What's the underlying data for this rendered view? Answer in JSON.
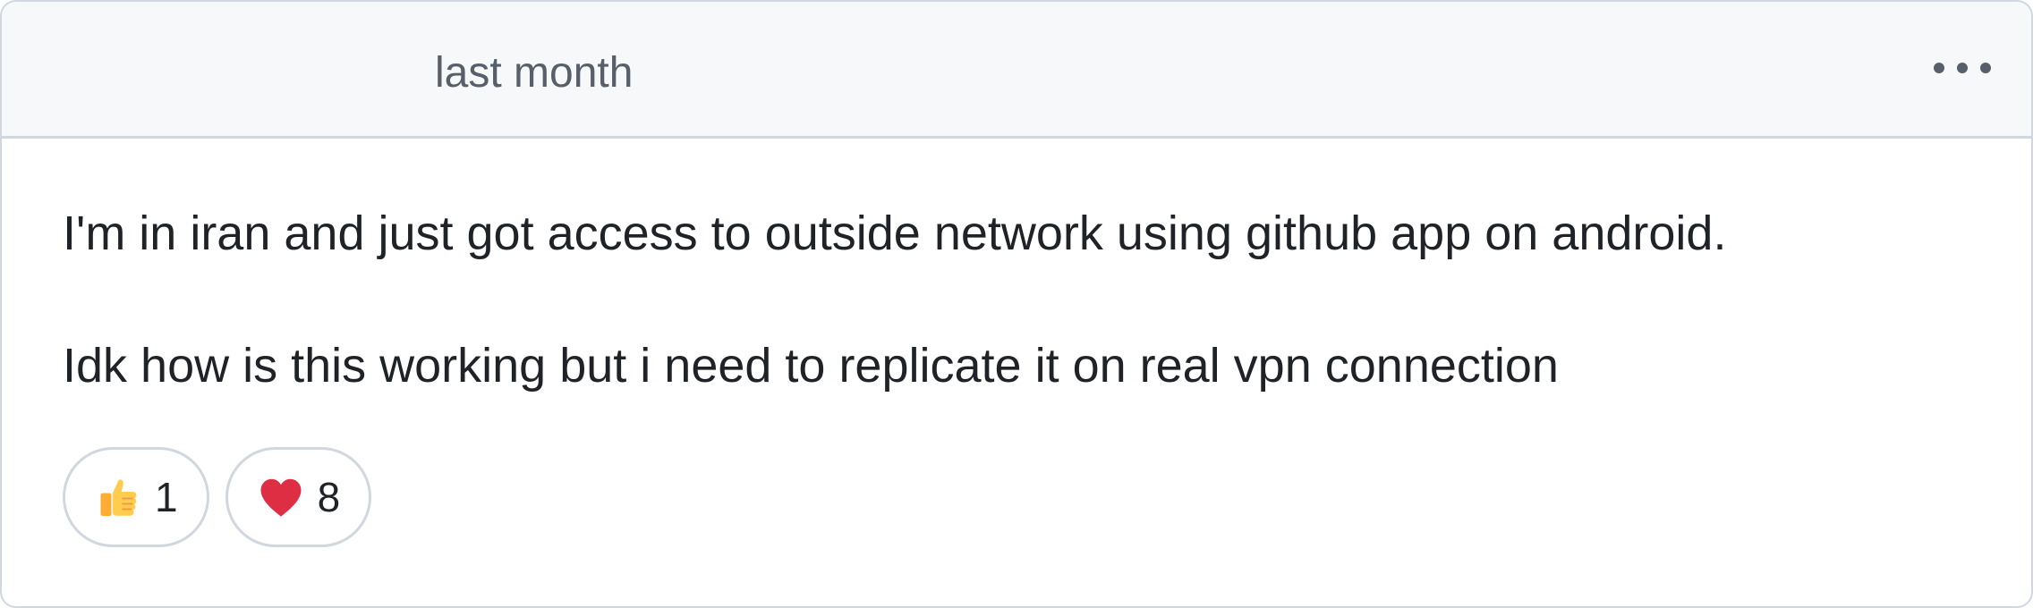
{
  "comment": {
    "timestamp": "last month",
    "menu_icon": "kebab-horizontal-icon",
    "paragraphs": [
      "I'm in iran and just got access to outside network using github app on android.",
      "Idk how is this working but i need to replicate it on real vpn connection"
    ],
    "reactions": [
      {
        "icon": "thumbs-up-icon",
        "count": "1"
      },
      {
        "icon": "heart-icon",
        "count": "8"
      }
    ]
  },
  "colors": {
    "border": "#d0d7de",
    "header_bg": "#f6f8fa",
    "muted_text": "#57606a",
    "body_text": "#1f2328",
    "heart": "#dd2e44",
    "thumb": "#ffcc4d"
  }
}
